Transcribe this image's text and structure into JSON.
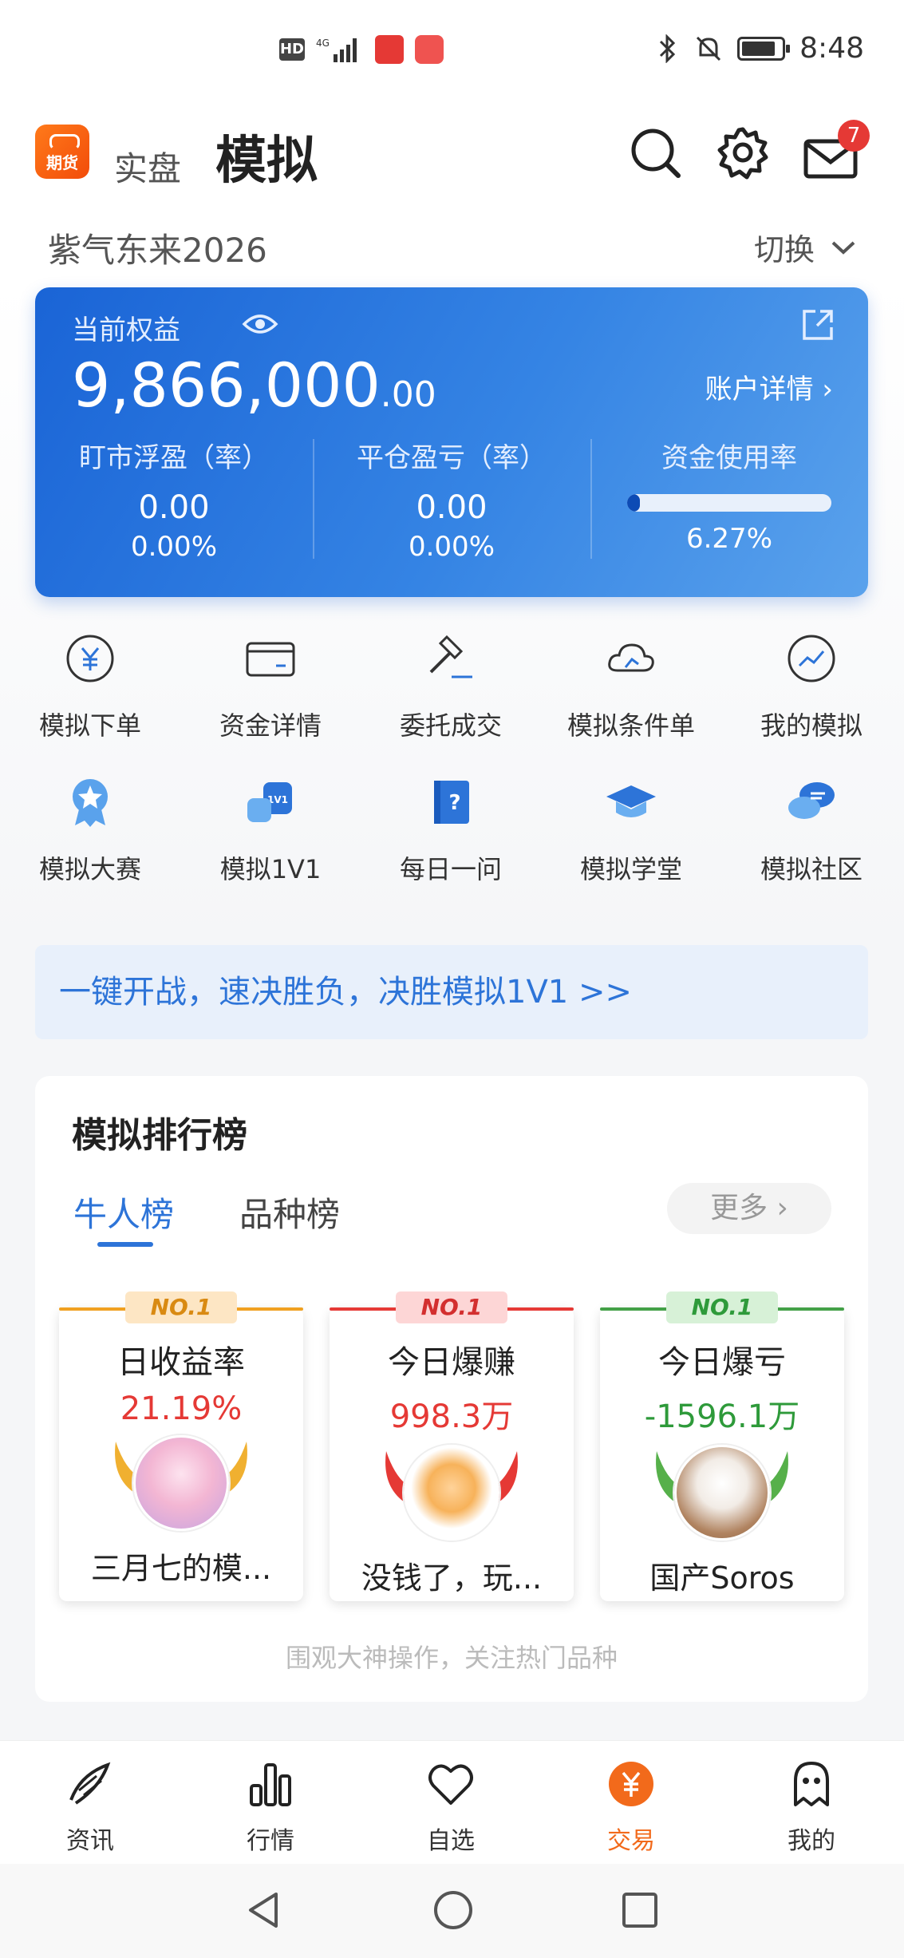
{
  "status_bar": {
    "hd": "HD",
    "network": "4G",
    "time": "8:48"
  },
  "header": {
    "logo_text": "期货",
    "tab_real": "实盘",
    "tab_sim": "模拟",
    "mail_badge": "7",
    "icons": [
      "search-icon",
      "gear-icon",
      "mail-icon"
    ]
  },
  "account": {
    "name": "紫气东来2026",
    "switch_label": "切换"
  },
  "equity": {
    "label": "当前权益",
    "value_int": "9,866,000",
    "value_dec": ".00",
    "detail_link": "账户详情 ›",
    "stats": [
      {
        "label": "盯市浮盈（率）",
        "v1": "0.00",
        "v2": "0.00%"
      },
      {
        "label": "平仓盈亏（率）",
        "v1": "0.00",
        "v2": "0.00%"
      },
      {
        "label": "资金使用率",
        "v2": "6.27%",
        "progress": 0.0627
      }
    ]
  },
  "menu": [
    {
      "label": "模拟下单",
      "icon": "yuan-circle-icon"
    },
    {
      "label": "资金详情",
      "icon": "card-icon"
    },
    {
      "label": "委托成交",
      "icon": "gavel-icon"
    },
    {
      "label": "模拟条件单",
      "icon": "cloud-icon"
    },
    {
      "label": "我的模拟",
      "icon": "trend-icon"
    },
    {
      "label": "模拟大赛",
      "icon": "medal-icon"
    },
    {
      "label": "模拟1V1",
      "icon": "boxing-icon"
    },
    {
      "label": "每日一问",
      "icon": "question-book-icon"
    },
    {
      "label": "模拟学堂",
      "icon": "graduation-cap-icon"
    },
    {
      "label": "模拟社区",
      "icon": "chat-bubbles-icon"
    }
  ],
  "promo": "一键开战，速决胜负，决胜模拟1V1 >>",
  "ranking": {
    "title": "模拟排行榜",
    "tabs": [
      "牛人榜",
      "品种榜"
    ],
    "more": "更多 ›",
    "boards": [
      {
        "badge": "NO.1",
        "title": "日收益率",
        "value": "21.19%",
        "name": "三月七的模...",
        "color": "#f0a020",
        "badge_bg": "#fde6c4",
        "badge_color": "#d98a12",
        "value_color": "#e53935"
      },
      {
        "badge": "NO.1",
        "title": "今日爆赚",
        "value": "998.3万",
        "name": "没钱了，玩...",
        "color": "#e53935",
        "badge_bg": "#fdd6d6",
        "badge_color": "#d32f2f",
        "value_color": "#e53935"
      },
      {
        "badge": "NO.1",
        "title": "今日爆亏",
        "value": "-1596.1万",
        "name": "国产Soros",
        "color": "#43a047",
        "badge_bg": "#d7f1d7",
        "badge_color": "#2e9a3a",
        "value_color": "#2e9a3a"
      }
    ],
    "footer": "围观大神操作，关注热门品种"
  },
  "bottom_nav": [
    {
      "label": "资讯",
      "icon": "news-feather-icon"
    },
    {
      "label": "行情",
      "icon": "bar-chart-icon"
    },
    {
      "label": "自选",
      "icon": "heart-icon"
    },
    {
      "label": "交易",
      "icon": "trade-yen-icon",
      "active": true
    },
    {
      "label": "我的",
      "icon": "profile-ghost-icon"
    }
  ]
}
